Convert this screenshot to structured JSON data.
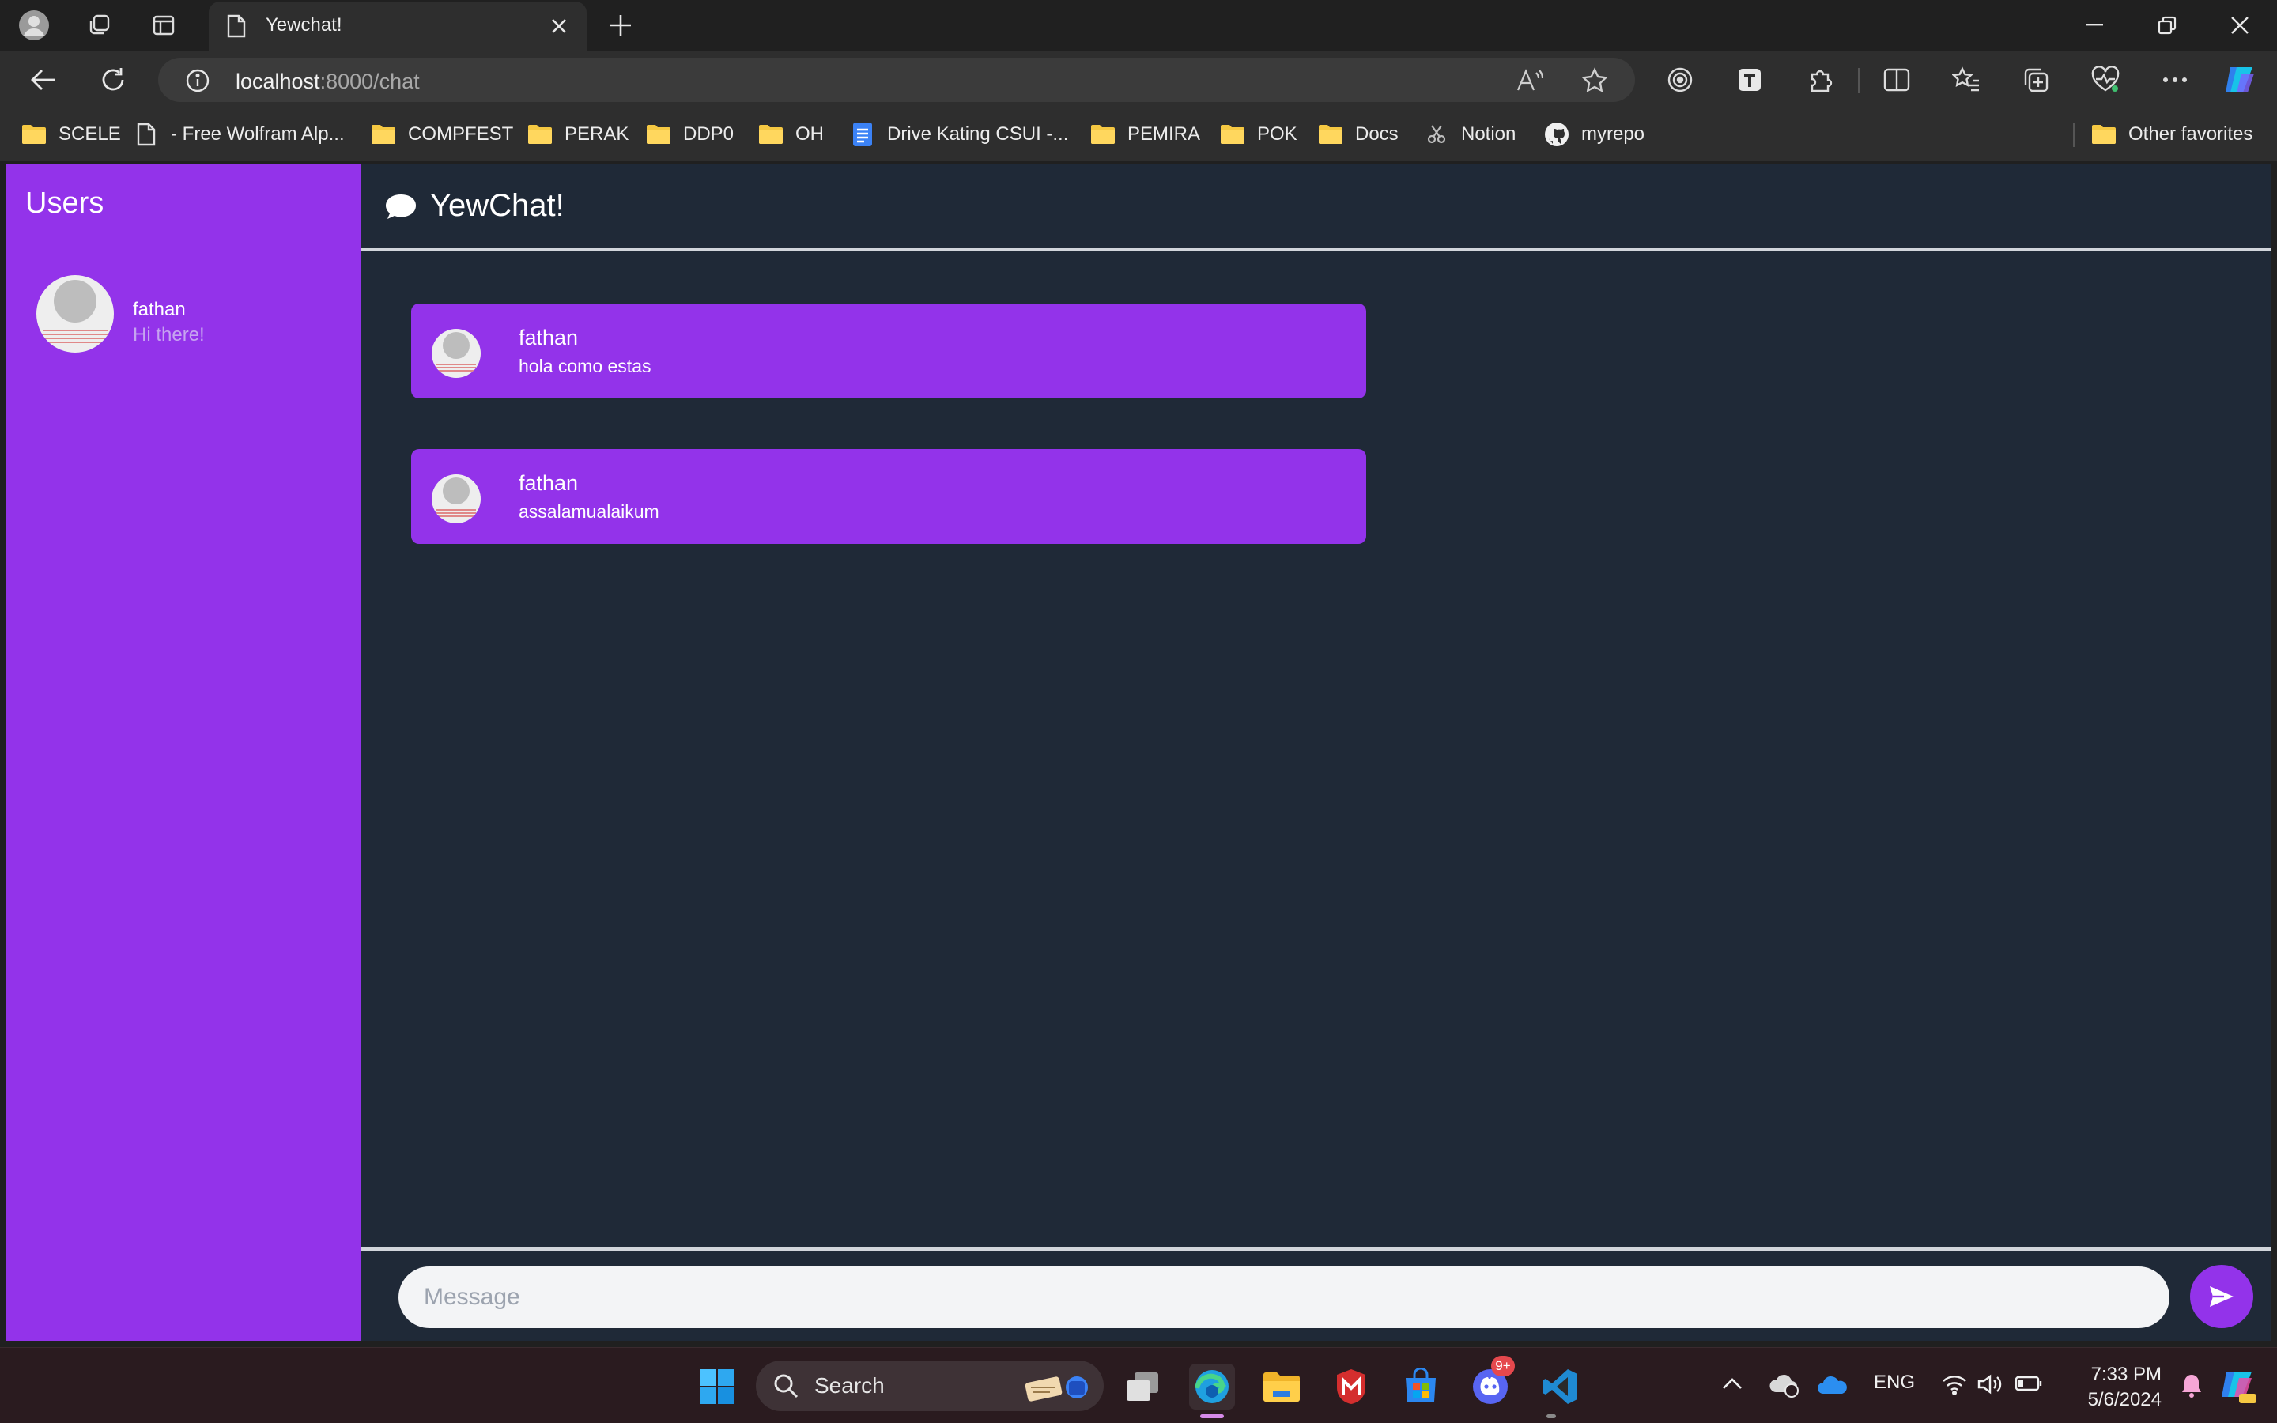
{
  "browser": {
    "tab_title": "Yewchat!",
    "url_host": "localhost",
    "url_rest": ":8000/chat"
  },
  "bookmarks": [
    {
      "label": "SCELE",
      "icon": "folder-icon"
    },
    {
      "label": "- Free Wolfram Alp...",
      "icon": "page-icon"
    },
    {
      "label": "COMPFEST",
      "icon": "folder-icon"
    },
    {
      "label": "PERAK",
      "icon": "folder-icon"
    },
    {
      "label": "DDP0",
      "icon": "folder-icon"
    },
    {
      "label": "OH",
      "icon": "folder-icon"
    },
    {
      "label": "Drive Kating CSUI -...",
      "icon": "docs-icon"
    },
    {
      "label": "PEMIRA",
      "icon": "folder-icon"
    },
    {
      "label": "POK",
      "icon": "folder-icon"
    },
    {
      "label": "Docs",
      "icon": "folder-icon"
    },
    {
      "label": "Notion",
      "icon": "notion-icon"
    },
    {
      "label": "myrepo",
      "icon": "github-icon"
    }
  ],
  "other_favorites": "Other favorites",
  "sidebar": {
    "title": "Users",
    "users": [
      {
        "name": "fathan",
        "preview": "Hi there!"
      }
    ]
  },
  "chat": {
    "title": "YewChat!",
    "messages": [
      {
        "user": "fathan",
        "text": "hola como estas"
      },
      {
        "user": "fathan",
        "text": "assalamualaikum"
      }
    ],
    "input_placeholder": "Message"
  },
  "taskbar": {
    "search_label": "Search",
    "language": "ENG",
    "time": "7:33 PM",
    "date": "5/6/2024",
    "discord_badge": "9+"
  },
  "colors": {
    "accent_purple": "#9333ea",
    "chat_bg": "#1f2937"
  }
}
